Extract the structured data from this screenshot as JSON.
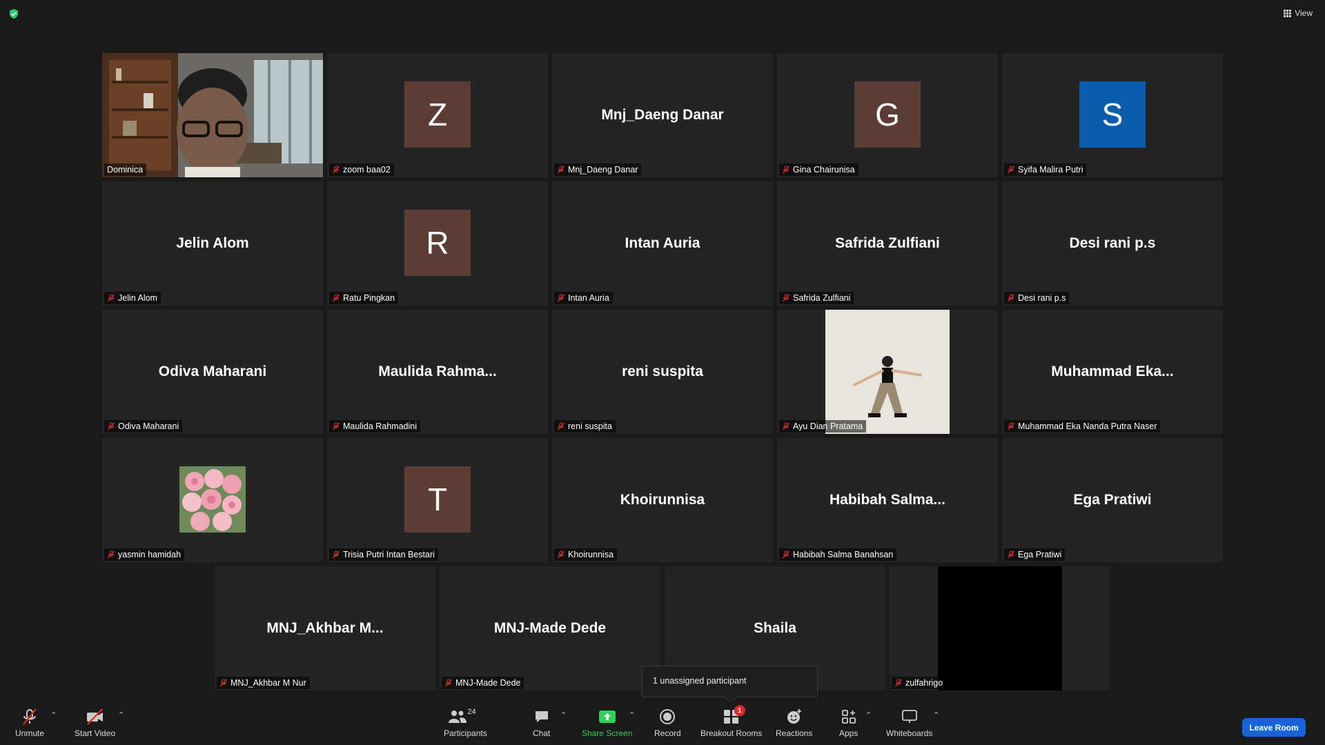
{
  "header": {
    "view_label": "View",
    "shield_color": "#2ecc71"
  },
  "gallery": {
    "rows": [
      [
        {
          "display": "video",
          "name": "Dominica",
          "active": true,
          "muted": false
        },
        {
          "display": "avatar",
          "name": "zoom baa02",
          "initial": "Z",
          "color": "#5c3d35",
          "muted": true
        },
        {
          "display": "bigname",
          "name": "Mnj_Daeng Danar",
          "big": "Mnj_Daeng Danar",
          "muted": true
        },
        {
          "display": "avatar",
          "name": "Gina Chairunisa",
          "initial": "G",
          "color": "#5c3d35",
          "muted": true
        },
        {
          "display": "avatar",
          "name": "Syifa Malira Putri",
          "initial": "S",
          "color": "#0b5cad",
          "muted": true
        }
      ],
      [
        {
          "display": "bigname",
          "name": "Jelin Alom",
          "big": "Jelin Alom",
          "muted": true
        },
        {
          "display": "avatar",
          "name": "Ratu Pingkan",
          "initial": "R",
          "color": "#5c3d35",
          "muted": true
        },
        {
          "display": "bigname",
          "name": "Intan Auria",
          "big": "Intan Auria",
          "muted": true
        },
        {
          "display": "bigname",
          "name": "Safrida Zulfiani",
          "big": "Safrida Zulfiani",
          "muted": true
        },
        {
          "display": "bigname",
          "name": "Desi rani p.s",
          "big": "Desi rani p.s",
          "muted": true
        }
      ],
      [
        {
          "display": "bigname",
          "name": "Odiva Maharani",
          "big": "Odiva Maharani",
          "muted": true
        },
        {
          "display": "bigname",
          "name": "Maulida Rahmadini",
          "big": "Maulida  Rahma...",
          "muted": true
        },
        {
          "display": "bigname",
          "name": "reni suspita",
          "big": "reni suspita",
          "muted": true
        },
        {
          "display": "tallphoto",
          "name": "Ayu Dian Pratama",
          "muted": true
        },
        {
          "display": "bigname",
          "name": "Muhammad Eka Nanda Putra Naser",
          "big": "Muhammad  Eka...",
          "muted": true
        }
      ],
      [
        {
          "display": "photo",
          "name": "yasmin hamidah",
          "muted": true
        },
        {
          "display": "avatar",
          "name": "Trisia Putri Intan Bestari",
          "initial": "T",
          "color": "#5c3d35",
          "muted": true
        },
        {
          "display": "bigname",
          "name": "Khoirunnisa",
          "big": "Khoirunnisa",
          "muted": true
        },
        {
          "display": "bigname",
          "name": "Habibah Salma Banahsan",
          "big": "Habibah  Salma...",
          "muted": true
        },
        {
          "display": "bigname",
          "name": "Ega Pratiwi",
          "big": "Ega Pratiwi",
          "muted": true
        }
      ],
      [
        {
          "display": "bigname",
          "name": "MNJ_Akhbar M Nur",
          "big": "MNJ_Akhbar  M...",
          "muted": true
        },
        {
          "display": "bigname",
          "name": "MNJ-Made Dede",
          "big": "MNJ-Made Dede",
          "muted": true
        },
        {
          "display": "bigname",
          "name": "Shaila",
          "big": "Shaila",
          "muted": true,
          "hide_label": true
        },
        {
          "display": "black",
          "name": "zulfahrigo",
          "muted": true
        }
      ]
    ]
  },
  "tooltip": {
    "text": "1 unassigned participant"
  },
  "toolbar": {
    "unmute": "Unmute",
    "start_video": "Start Video",
    "participants": "Participants",
    "participant_count": "24",
    "chat": "Chat",
    "share_screen": "Share Screen",
    "record": "Record",
    "breakout_rooms": "Breakout Rooms",
    "breakout_badge": "1",
    "reactions": "Reactions",
    "apps": "Apps",
    "whiteboards": "Whiteboards",
    "leave": "Leave Room"
  }
}
